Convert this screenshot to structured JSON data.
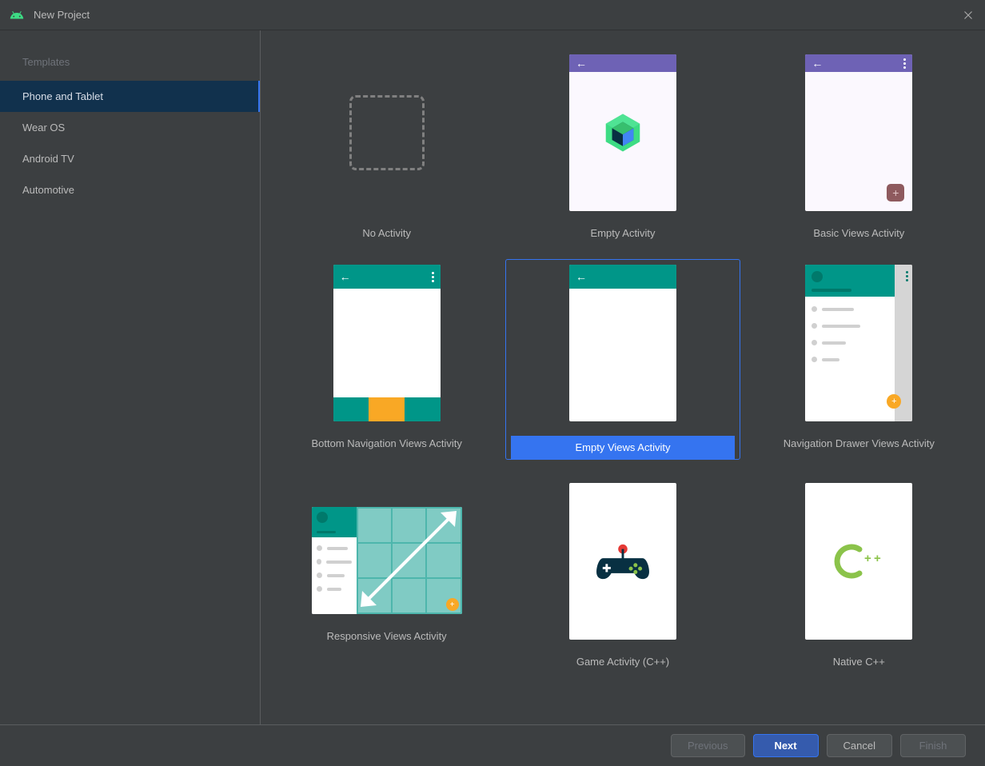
{
  "title": "New Project",
  "sidebar": {
    "header": "Templates",
    "items": [
      {
        "label": "Phone and Tablet",
        "selected": true
      },
      {
        "label": "Wear OS",
        "selected": false
      },
      {
        "label": "Android TV",
        "selected": false
      },
      {
        "label": "Automotive",
        "selected": false
      }
    ]
  },
  "templates": [
    {
      "label": "No Activity",
      "selected": false
    },
    {
      "label": "Empty Activity",
      "selected": false
    },
    {
      "label": "Basic Views Activity",
      "selected": false
    },
    {
      "label": "Bottom Navigation Views Activity",
      "selected": false
    },
    {
      "label": "Empty Views Activity",
      "selected": true
    },
    {
      "label": "Navigation Drawer Views Activity",
      "selected": false
    },
    {
      "label": "Responsive Views Activity",
      "selected": false
    },
    {
      "label": "Game Activity (C++)",
      "selected": false
    },
    {
      "label": "Native C++",
      "selected": false
    }
  ],
  "footer": {
    "previous": "Previous",
    "next": "Next",
    "cancel": "Cancel",
    "finish": "Finish"
  }
}
